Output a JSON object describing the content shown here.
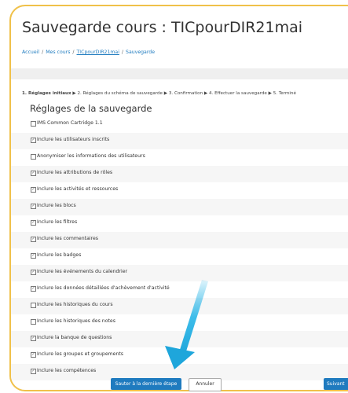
{
  "page": {
    "title": "Sauvegarde cours : TICpourDIR21mai"
  },
  "breadcrumb": {
    "items": [
      "Accueil",
      "Mes cours",
      "TICpourDIR21mai",
      "Sauvegarde"
    ],
    "separator": "/"
  },
  "steps": {
    "current": "1. Réglages initiaux",
    "rest": "▶ 2. Réglages du schéma de sauvegarde ▶ 3. Confirmation ▶ 4. Effectuer la sauvegarde ▶ 5. Terminé"
  },
  "section": {
    "title": "Réglages de la sauvegarde"
  },
  "options": [
    {
      "label": "IMS Common Cartridge 1.1",
      "checked": false
    },
    {
      "label": "Inclure les utilisateurs inscrits",
      "checked": true
    },
    {
      "label": "Anonymiser les informations des utilisateurs",
      "checked": false
    },
    {
      "label": "Inclure les attributions de rôles",
      "checked": true
    },
    {
      "label": "Inclure les activités et ressources",
      "checked": true
    },
    {
      "label": "Inclure les blocs",
      "checked": true
    },
    {
      "label": "Inclure les filtres",
      "checked": true
    },
    {
      "label": "Inclure les commentaires",
      "checked": true
    },
    {
      "label": "Inclure les badges",
      "checked": true
    },
    {
      "label": "Inclure les événements du calendrier",
      "checked": true
    },
    {
      "label": "Inclure les données détaillées d'achèvement d'activité",
      "checked": true
    },
    {
      "label": "Inclure les historiques du cours",
      "checked": false
    },
    {
      "label": "Inclure les historiques des notes",
      "checked": false
    },
    {
      "label": "Inclure la banque de questions",
      "checked": true
    },
    {
      "label": "Inclure les groupes et groupements",
      "checked": true
    },
    {
      "label": "Inclure les compétences",
      "checked": true
    }
  ],
  "buttons": {
    "skip_label": "Sauter à la dernière étape",
    "cancel_label": "Annuler",
    "next_label": "Suivant"
  },
  "colors": {
    "accent": "#1f7bbf",
    "frame": "#f0c14a",
    "arrow": "#29b6e8"
  }
}
